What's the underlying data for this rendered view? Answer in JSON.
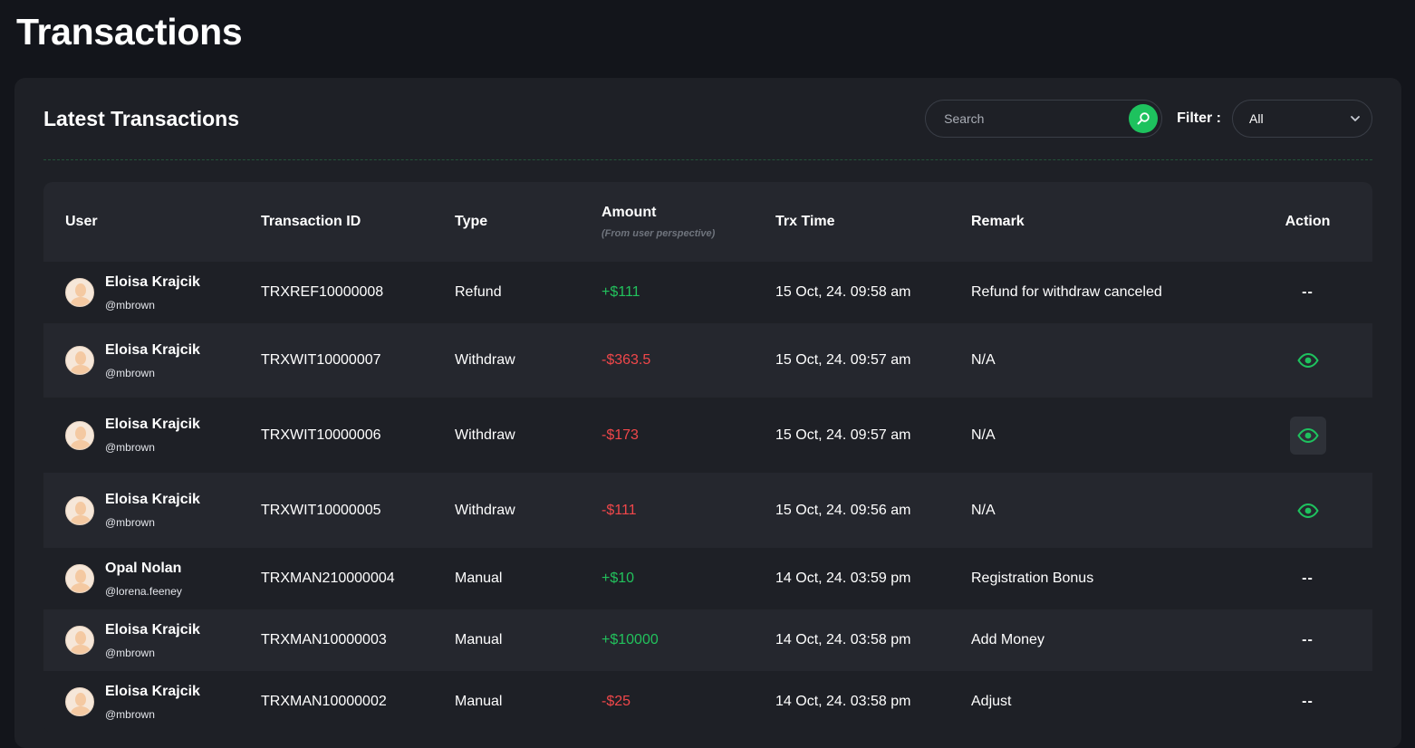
{
  "page": {
    "title": "Transactions"
  },
  "card": {
    "title": "Latest Transactions"
  },
  "search": {
    "placeholder": "Search",
    "icon": "search-icon"
  },
  "filter": {
    "label": "Filter :",
    "value": "All"
  },
  "colors": {
    "accent": "#1ec25e",
    "positive": "#22c15c",
    "negative": "#f0474a",
    "background": "#13151b",
    "card": "#1e2026"
  },
  "table": {
    "headers": {
      "user": "User",
      "trx_id": "Transaction ID",
      "type": "Type",
      "amount": "Amount",
      "amount_sub": "(From user perspective)",
      "time": "Trx Time",
      "remark": "Remark",
      "action": "Action"
    },
    "rows": [
      {
        "name": "Eloisa Krajcik",
        "handle": "@mbrown",
        "trx_id": "TRXREF10000008",
        "type": "Refund",
        "amount": "+$111",
        "time": "15 Oct, 24. 09:58 am",
        "remark": "Refund for withdraw canceled",
        "action": "--"
      },
      {
        "name": "Eloisa Krajcik",
        "handle": "@mbrown",
        "trx_id": "TRXWIT10000007",
        "type": "Withdraw",
        "amount": "-$363.5",
        "time": "15 Oct, 24. 09:57 am",
        "remark": "N/A",
        "action": "eye-icon"
      },
      {
        "name": "Eloisa Krajcik",
        "handle": "@mbrown",
        "trx_id": "TRXWIT10000006",
        "type": "Withdraw",
        "amount": "-$173",
        "time": "15 Oct, 24. 09:57 am",
        "remark": "N/A",
        "action": "eye-icon"
      },
      {
        "name": "Eloisa Krajcik",
        "handle": "@mbrown",
        "trx_id": "TRXWIT10000005",
        "type": "Withdraw",
        "amount": "-$111",
        "time": "15 Oct, 24. 09:56 am",
        "remark": "N/A",
        "action": "eye-icon"
      },
      {
        "name": "Opal Nolan",
        "handle": "@lorena.feeney",
        "trx_id": "TRXMAN210000004",
        "type": "Manual",
        "amount": "+$10",
        "time": "14 Oct, 24. 03:59 pm",
        "remark": "Registration Bonus",
        "action": "--"
      },
      {
        "name": "Eloisa Krajcik",
        "handle": "@mbrown",
        "trx_id": "TRXMAN10000003",
        "type": "Manual",
        "amount": "+$10000",
        "time": "14 Oct, 24. 03:58 pm",
        "remark": "Add Money",
        "action": "--"
      },
      {
        "name": "Eloisa Krajcik",
        "handle": "@mbrown",
        "trx_id": "TRXMAN10000002",
        "type": "Manual",
        "amount": "-$25",
        "time": "14 Oct, 24. 03:58 pm",
        "remark": "Adjust",
        "action": "--"
      }
    ]
  }
}
